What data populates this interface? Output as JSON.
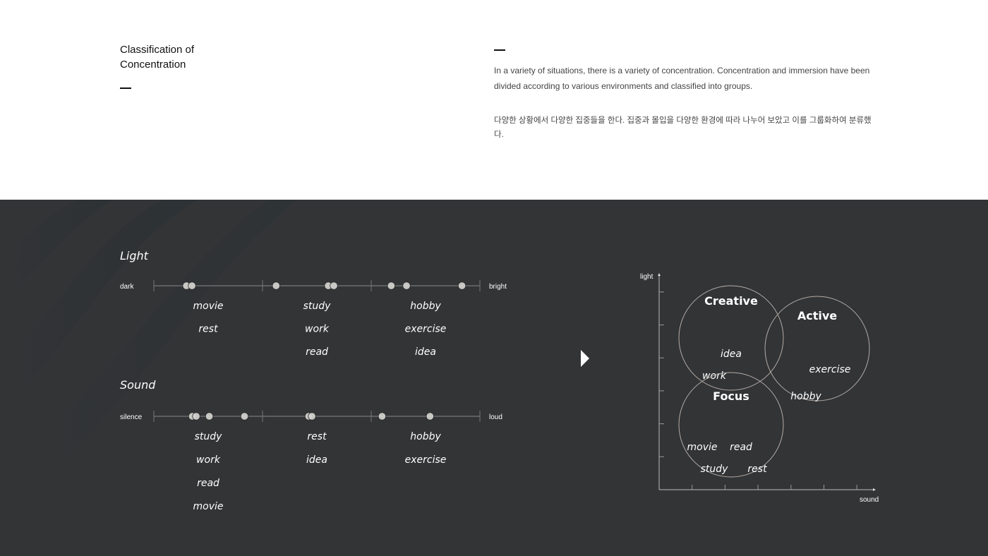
{
  "header": {
    "title_line1": "Classification of",
    "title_line2": "Concentration",
    "description_en": "In a variety of situations, there is a variety of concentration. Concentration and immersion have been divided according to various environments and classified into groups.",
    "description_ko": "다양한 상황에서 다양한 집중들을 한다. 집중과 몰입을 다양한 환경에 따라 나누어 보았고 이를 그룹화하여 분류했다."
  },
  "scales": [
    {
      "title": "Light",
      "min_label": "dark",
      "max_label": "bright",
      "segments": 3,
      "dot_positions": [
        0.1,
        0.117,
        0.375,
        0.535,
        0.552,
        0.728,
        0.775,
        0.945
      ],
      "groups": [
        {
          "words": [
            "movie",
            "rest"
          ]
        },
        {
          "words": [
            "study",
            "work",
            "read"
          ]
        },
        {
          "words": [
            "hobby",
            "exercise",
            "idea"
          ]
        }
      ]
    },
    {
      "title": "Sound",
      "min_label": "silence",
      "max_label": "loud",
      "segments": 3,
      "dot_positions": [
        0.118,
        0.13,
        0.17,
        0.278,
        0.475,
        0.485,
        0.7,
        0.847
      ],
      "groups": [
        {
          "words": [
            "study",
            "work",
            "read",
            "movie"
          ]
        },
        {
          "words": [
            "rest",
            "idea"
          ]
        },
        {
          "words": [
            "hobby",
            "exercise"
          ]
        }
      ]
    }
  ],
  "arrow_icon": "play-triangle",
  "chart_data": {
    "type": "scatter",
    "title": "",
    "xlabel": "sound",
    "ylabel": "light",
    "x_ticks": 6,
    "y_ticks": 6,
    "clusters": [
      {
        "name": "Creative",
        "center": [
          1.0,
          4.2
        ],
        "radius": 1.6,
        "words": [
          "idea",
          "work"
        ]
      },
      {
        "name": "Active",
        "center": [
          2.3,
          3.9
        ],
        "radius": 1.6,
        "words": [
          "exercise",
          "hobby"
        ]
      },
      {
        "name": "Focus",
        "center": [
          1.0,
          1.5
        ],
        "radius": 1.6,
        "words": [
          "movie",
          "read",
          "study",
          "rest"
        ]
      }
    ]
  }
}
